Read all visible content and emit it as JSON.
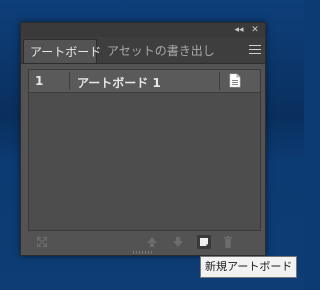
{
  "window": {
    "collapse_glyph": "◂◂",
    "close_glyph": "✕"
  },
  "tabs": [
    {
      "label": "アートボード",
      "active": true
    },
    {
      "label": "アセットの書き出し",
      "active": false
    }
  ],
  "artboards": [
    {
      "number": "1",
      "name": "アートボード 1"
    }
  ],
  "footer_icons": [
    "rearrange-icon",
    "move-up-icon",
    "move-down-icon",
    "new-artboard-icon",
    "delete-icon"
  ],
  "tooltip": {
    "text": "新規アートボード"
  },
  "colors": {
    "panel_bg": "#535353",
    "tab_bar_bg": "#3e3e3e",
    "desktop_bg": "#0c3a72",
    "tooltip_bg": "#f2f2f2"
  }
}
